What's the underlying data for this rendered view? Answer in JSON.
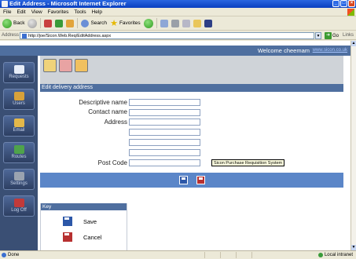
{
  "window": {
    "title": "Edit Address - Microsoft Internet Explorer"
  },
  "menu": [
    "File",
    "Edit",
    "View",
    "Favorites",
    "Tools",
    "Help"
  ],
  "toolbar": {
    "back": "Back",
    "search": "Search",
    "favorites": "Favorites"
  },
  "address": {
    "label": "Address",
    "url": "http://joe/Sicon.Web.Req/EditAddress.aspx",
    "go": "Go",
    "links": "Links"
  },
  "header": {
    "welcome": "Welcome cheemam",
    "site_link": "www.sicon.co.uk"
  },
  "nav": [
    "Requests",
    "Users",
    "Email",
    "Routes",
    "Settings",
    "Log Off"
  ],
  "section_title": "Edit delivery address",
  "form": {
    "descriptive_name": "Descriptive name",
    "contact_name": "Contact name",
    "address": "Address",
    "post_code": "Post Code",
    "descriptive_name_value": "",
    "contact_name_value": "",
    "address_line1": "",
    "address_line2": "",
    "address_line3": "",
    "address_line4": "",
    "post_code_value": ""
  },
  "tooltip": "Sicon Purchase Requisition System",
  "key": {
    "title": "Key",
    "save": "Save",
    "cancel": "Cancel"
  },
  "status": {
    "left": "Done",
    "zone": "Local intranet"
  },
  "colors": {
    "header": "#4f6f9f",
    "nav": "#3a4f74",
    "button_bar": "#5b86c8"
  }
}
